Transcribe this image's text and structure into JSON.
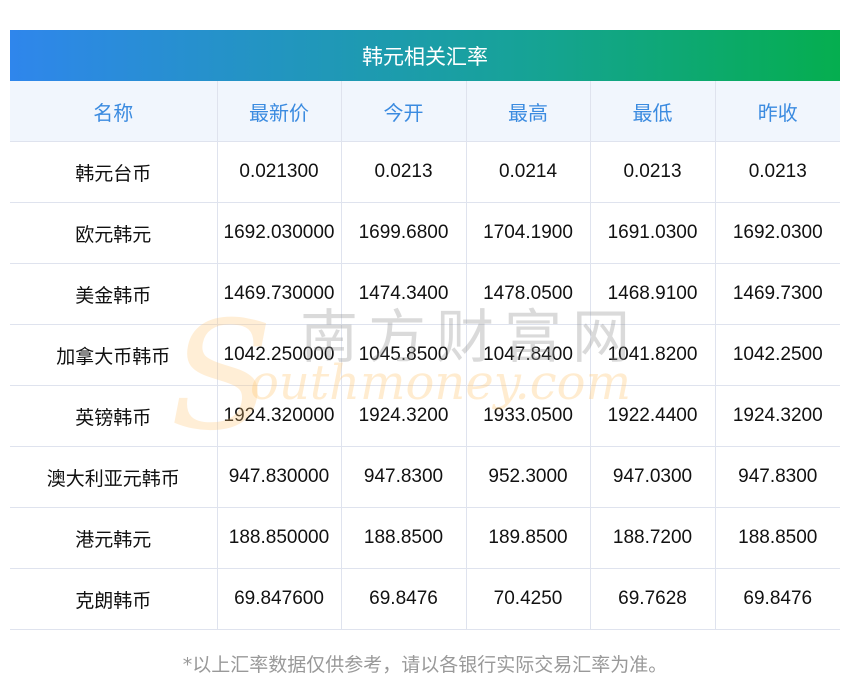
{
  "title": "韩元相关汇率",
  "columns": [
    "名称",
    "最新价",
    "今开",
    "最高",
    "最低",
    "昨收"
  ],
  "rows": [
    [
      "韩元台币",
      "0.021300",
      "0.0213",
      "0.0214",
      "0.0213",
      "0.0213"
    ],
    [
      "欧元韩元",
      "1692.030000",
      "1699.6800",
      "1704.1900",
      "1691.0300",
      "1692.0300"
    ],
    [
      "美金韩币",
      "1469.730000",
      "1474.3400",
      "1478.0500",
      "1468.9100",
      "1469.7300"
    ],
    [
      "加拿大币韩币",
      "1042.250000",
      "1045.8500",
      "1047.8400",
      "1041.8200",
      "1042.2500"
    ],
    [
      "英镑韩币",
      "1924.320000",
      "1924.3200",
      "1933.0500",
      "1922.4400",
      "1924.3200"
    ],
    [
      "澳大利亚元韩币",
      "947.830000",
      "947.8300",
      "952.3000",
      "947.0300",
      "947.8300"
    ],
    [
      "港元韩元",
      "188.850000",
      "188.8500",
      "189.8500",
      "188.7200",
      "188.8500"
    ],
    [
      "克朗韩币",
      "69.847600",
      "69.8476",
      "70.4250",
      "69.7628",
      "69.8476"
    ]
  ],
  "footer": "*以上汇率数据仅供参考，请以各银行实际交易汇率为准。",
  "watermark": {
    "cn": "南方财富网",
    "s": "S",
    "en": "outhmoney.com"
  }
}
